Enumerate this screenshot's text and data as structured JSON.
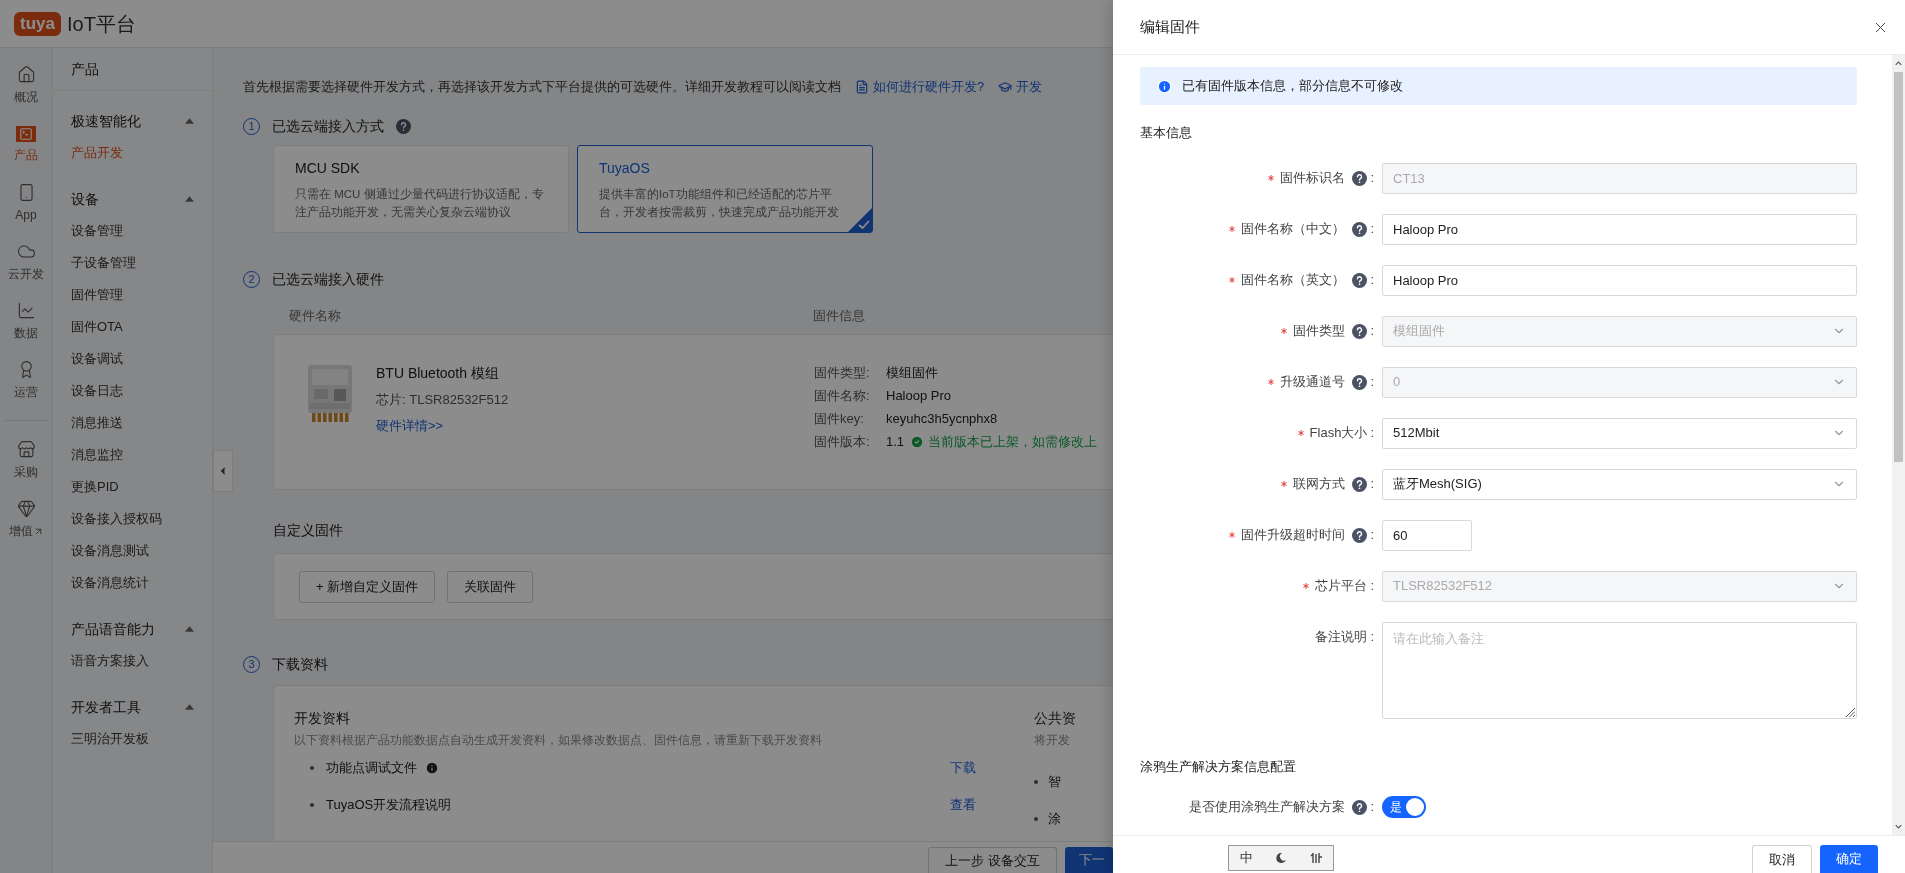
{
  "top_bar": {
    "logo": "tuya",
    "title": "IoT平台"
  },
  "icon_rail": [
    {
      "label": "概况",
      "selected": false
    },
    {
      "label": "产品",
      "selected": true
    },
    {
      "label": "App",
      "selected": false
    },
    {
      "label": "云开发",
      "selected": false
    },
    {
      "label": "数据",
      "selected": false
    },
    {
      "label": "运营",
      "selected": false
    },
    {
      "label": "采购",
      "selected": false
    },
    {
      "label": "增值",
      "selected": false
    }
  ],
  "sidebar": {
    "title": "产品",
    "groups": [
      {
        "title": "极速智能化",
        "expanded": true,
        "items": [
          {
            "label": "产品开发",
            "selected": true
          }
        ]
      },
      {
        "title": "设备",
        "expanded": true,
        "items": [
          {
            "label": "设备管理",
            "selected": false
          },
          {
            "label": "子设备管理",
            "selected": false
          },
          {
            "label": "固件管理",
            "selected": false
          },
          {
            "label": "固件OTA",
            "selected": false
          },
          {
            "label": "设备调试",
            "selected": false
          },
          {
            "label": "设备日志",
            "selected": false
          },
          {
            "label": "消息推送",
            "selected": false
          },
          {
            "label": "消息监控",
            "selected": false
          },
          {
            "label": "更换PID",
            "selected": false
          },
          {
            "label": "设备接入授权码",
            "selected": false
          },
          {
            "label": "设备消息测试",
            "selected": false
          },
          {
            "label": "设备消息统计",
            "selected": false
          }
        ]
      },
      {
        "title": "产品语音能力",
        "expanded": true,
        "items": [
          {
            "label": "语音方案接入",
            "selected": false
          }
        ]
      },
      {
        "title": "开发者工具",
        "expanded": true,
        "items": [
          {
            "label": "三明治开发板",
            "selected": false
          }
        ]
      }
    ]
  },
  "content": {
    "intro": "首先根据需要选择硬件开发方式，再选择该开发方式下平台提供的可选硬件。详细开发教程可以阅读文档",
    "links": [
      "如何进行硬件开发?",
      "开发"
    ],
    "steps": [
      {
        "number": "1",
        "title": "已选云端接入方式"
      },
      {
        "number": "2",
        "title": "已选云端接入硬件"
      },
      {
        "number": "3",
        "title": "下载资料"
      }
    ],
    "access_cards": [
      {
        "title": "MCU SDK",
        "description": "只需在 MCU 侧通过少量代码进行协议适配，专注产品功能开发，无需关心复杂云端协议",
        "selected": false
      },
      {
        "title": "TuyaOS",
        "description": "提供丰富的IoT功能组件和已经适配的芯片平台，开发者按需裁剪，快速完成产品功能开发",
        "selected": true
      }
    ],
    "hardware_table": {
      "columns": [
        "硬件名称",
        "固件信息"
      ],
      "row": {
        "name": "BTU Bluetooth 模组",
        "chip": "芯片: TLSR82532F512",
        "details_link": "硬件详情>>",
        "firmware": [
          {
            "label": "固件类型:",
            "value": "模组固件"
          },
          {
            "label": "固件名称:",
            "value": "Haloop Pro"
          },
          {
            "label": "固件key:",
            "value": "keyuhc3h5ycnphx8"
          },
          {
            "label": "固件版本:",
            "value": "1.1"
          }
        ],
        "status": "当前版本已上架，如需修改上"
      }
    },
    "custom_firmware": {
      "title": "自定义固件",
      "buttons": [
        "+ 新增自定义固件",
        "关联固件"
      ]
    },
    "downloads": {
      "title": "开发资料",
      "description": "以下资料根据产品功能数据点自动生成开发资料，如果修改数据点、固件信息，请重新下载开发资料",
      "items": [
        {
          "label": "功能点调试文件",
          "info": true,
          "action": "下载"
        },
        {
          "label": "TuyaOS开发流程说明",
          "info": false,
          "action": "查看"
        }
      ],
      "public_title": "公共资",
      "public_description": "将开发",
      "public_items": [
        "智",
        "涂"
      ]
    },
    "footer_buttons": [
      {
        "label": "上一步 设备交互",
        "primary": false
      },
      {
        "label": "下一",
        "primary": true
      }
    ]
  },
  "drawer": {
    "title": "编辑固件",
    "alert": "已有固件版本信息，部分信息不可修改",
    "section": "基本信息",
    "fields": [
      {
        "kind": "input",
        "label": "固件标识名",
        "colon": ":",
        "required": true,
        "help": true,
        "value": "CT13",
        "disabled": true
      },
      {
        "kind": "input",
        "label": "固件名称（中文）",
        "colon": ":",
        "required": true,
        "help": true,
        "value": "Haloop Pro",
        "disabled": false
      },
      {
        "kind": "input",
        "label": "固件名称（英文）",
        "colon": ":",
        "required": true,
        "help": true,
        "value": "Haloop Pro",
        "disabled": false
      },
      {
        "kind": "select",
        "label": "固件类型",
        "colon": ":",
        "required": true,
        "help": true,
        "value": "模组固件",
        "disabled": true
      },
      {
        "kind": "select",
        "label": "升级通道号",
        "colon": ":",
        "required": true,
        "help": true,
        "value": "0",
        "disabled": true
      },
      {
        "kind": "select",
        "label": "Flash大小",
        "colon": ":",
        "required": true,
        "help": false,
        "value": "512Mbit",
        "disabled": false
      },
      {
        "kind": "select",
        "label": "联网方式",
        "colon": ":",
        "required": true,
        "help": true,
        "value": "蓝牙Mesh(SIG)",
        "disabled": false
      },
      {
        "kind": "short",
        "label": "固件升级超时时间",
        "colon": ":",
        "required": true,
        "help": true,
        "value": "60",
        "disabled": false
      },
      {
        "kind": "select",
        "label": "芯片平台",
        "colon": ":",
        "required": true,
        "help": false,
        "value": "TLSR82532F512",
        "disabled": true
      },
      {
        "kind": "textarea",
        "label": "备注说明",
        "colon": ":",
        "required": false,
        "help": false,
        "placeholder": "请在此输入备注"
      }
    ],
    "section2": "涂鸦生产解决方案信息配置",
    "toggle": {
      "label": "是否使用涂鸦生产解决方案",
      "colon": ":",
      "help": true,
      "on": true,
      "text": "是"
    },
    "buttons": [
      {
        "label": "取消",
        "primary": false
      },
      {
        "label": "确定",
        "primary": true
      }
    ]
  },
  "ime_toolbar": {
    "mode": "中"
  }
}
